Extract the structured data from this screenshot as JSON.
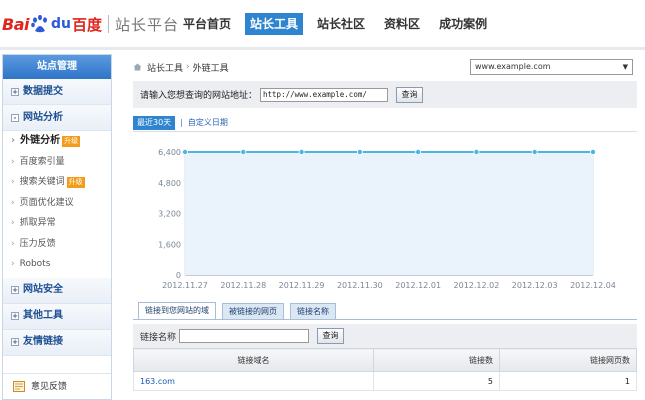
{
  "header": {
    "logo_bai": "Bai",
    "logo_du": "du",
    "logo_cn": "百度",
    "site_name": "站长平台",
    "nav": [
      {
        "label": "平台首页",
        "active": false
      },
      {
        "label": "站长工具",
        "active": true
      },
      {
        "label": "站长社区",
        "active": false
      },
      {
        "label": "资料区",
        "active": false
      },
      {
        "label": "成功案例",
        "active": false
      }
    ]
  },
  "sidebar": {
    "title": "站点管理",
    "sections": [
      {
        "label": "数据提交",
        "expand": "+"
      },
      {
        "label": "网站分析",
        "expand": "-"
      }
    ],
    "sub_items": [
      {
        "label": "外链分析",
        "badge": "升级"
      },
      {
        "label": "百度索引量",
        "badge": ""
      },
      {
        "label": "搜索关键词",
        "badge": "升级"
      },
      {
        "label": "页面优化建议",
        "badge": ""
      },
      {
        "label": "抓取异常",
        "badge": ""
      },
      {
        "label": "压力反馈",
        "badge": ""
      },
      {
        "label": "Robots",
        "badge": ""
      }
    ],
    "sections_after": [
      {
        "label": "网站安全",
        "expand": "+"
      },
      {
        "label": "其他工具",
        "expand": "+"
      },
      {
        "label": "友情链接",
        "expand": "+"
      }
    ],
    "feedback": "意见反馈"
  },
  "main": {
    "breadcrumb": [
      "站长工具",
      "外链工具"
    ],
    "site_select": "www.example.com",
    "query_label": "请输入您想查询的网站地址：",
    "query_value": "http://www.example.com/",
    "query_button": "查询",
    "range_recent": "最近30天",
    "range_sep": "|",
    "range_custom": "自定义日期",
    "tabs": [
      "链接到您网站的域",
      "被链接的网页",
      "链接名称"
    ],
    "filter_label": "链接名称",
    "filter_button": "查询",
    "table": {
      "headers": [
        "链接域名",
        "链接数",
        "链接网页数"
      ],
      "rows": [
        [
          "163.com",
          "5",
          "1"
        ]
      ]
    }
  },
  "colors": {
    "accent": "#2e84cf",
    "line": "#4bb7df",
    "area": "#eaf3fb",
    "badge": "#f39b1b"
  },
  "chart_data": {
    "type": "line",
    "categories": [
      "2012.11.27",
      "2012.11.28",
      "2012.11.29",
      "2012.11.30",
      "2012.12.01",
      "2012.12.02",
      "2012.12.03",
      "2012.12.04"
    ],
    "series": [
      {
        "values": [
          6400,
          6400,
          6400,
          6400,
          6400,
          6400,
          6400,
          6400
        ]
      }
    ],
    "yticks": [
      0,
      1600,
      3200,
      4800,
      6400
    ],
    "ylim": [
      0,
      6400
    ],
    "grid": true
  }
}
